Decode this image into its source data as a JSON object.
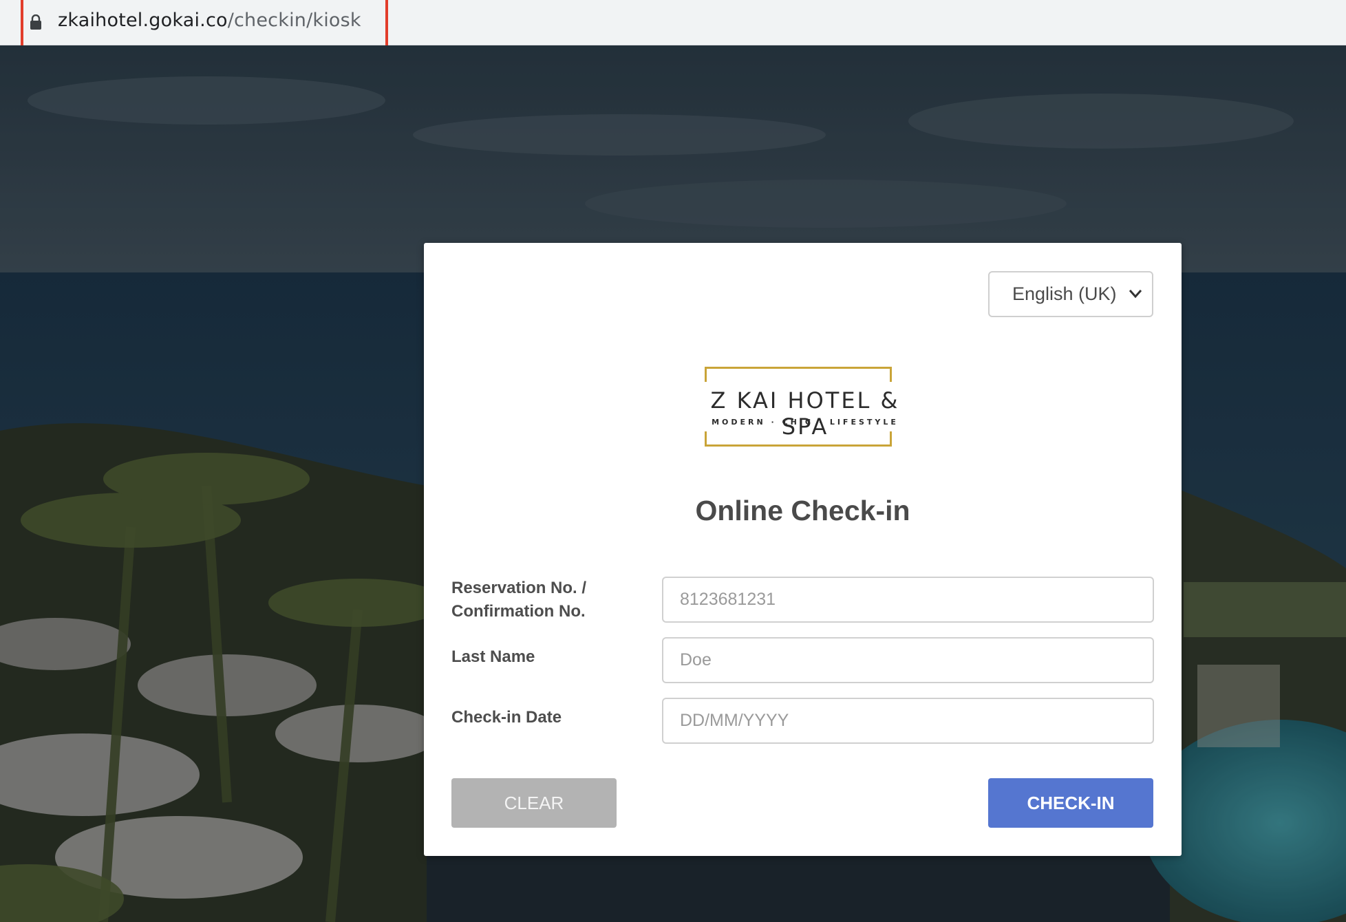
{
  "browser": {
    "url_host": "zkaihotel.gokai.co",
    "url_path": "/checkin/kiosk"
  },
  "card": {
    "language": "English (UK)",
    "logo": {
      "name": "Z KAI HOTEL & SPA",
      "tagline": "MODERN · CHIC · LIFESTYLE"
    },
    "title": "Online Check-in",
    "fields": [
      {
        "label_line1": "Reservation No. /",
        "label_line2": "Confirmation No.",
        "placeholder": "8123681231"
      },
      {
        "label_line1": "Last Name",
        "placeholder": "Doe"
      },
      {
        "label_line1": "Check-in Date",
        "placeholder": "DD/MM/YYYY"
      }
    ],
    "clear_label": "CLEAR",
    "checkin_label": "CHECK-IN"
  },
  "colors": {
    "primary_button": "#5576d0",
    "clear_button": "#b3b3b3",
    "logo_gold": "#c9a438",
    "highlight": "#e23d2b"
  }
}
